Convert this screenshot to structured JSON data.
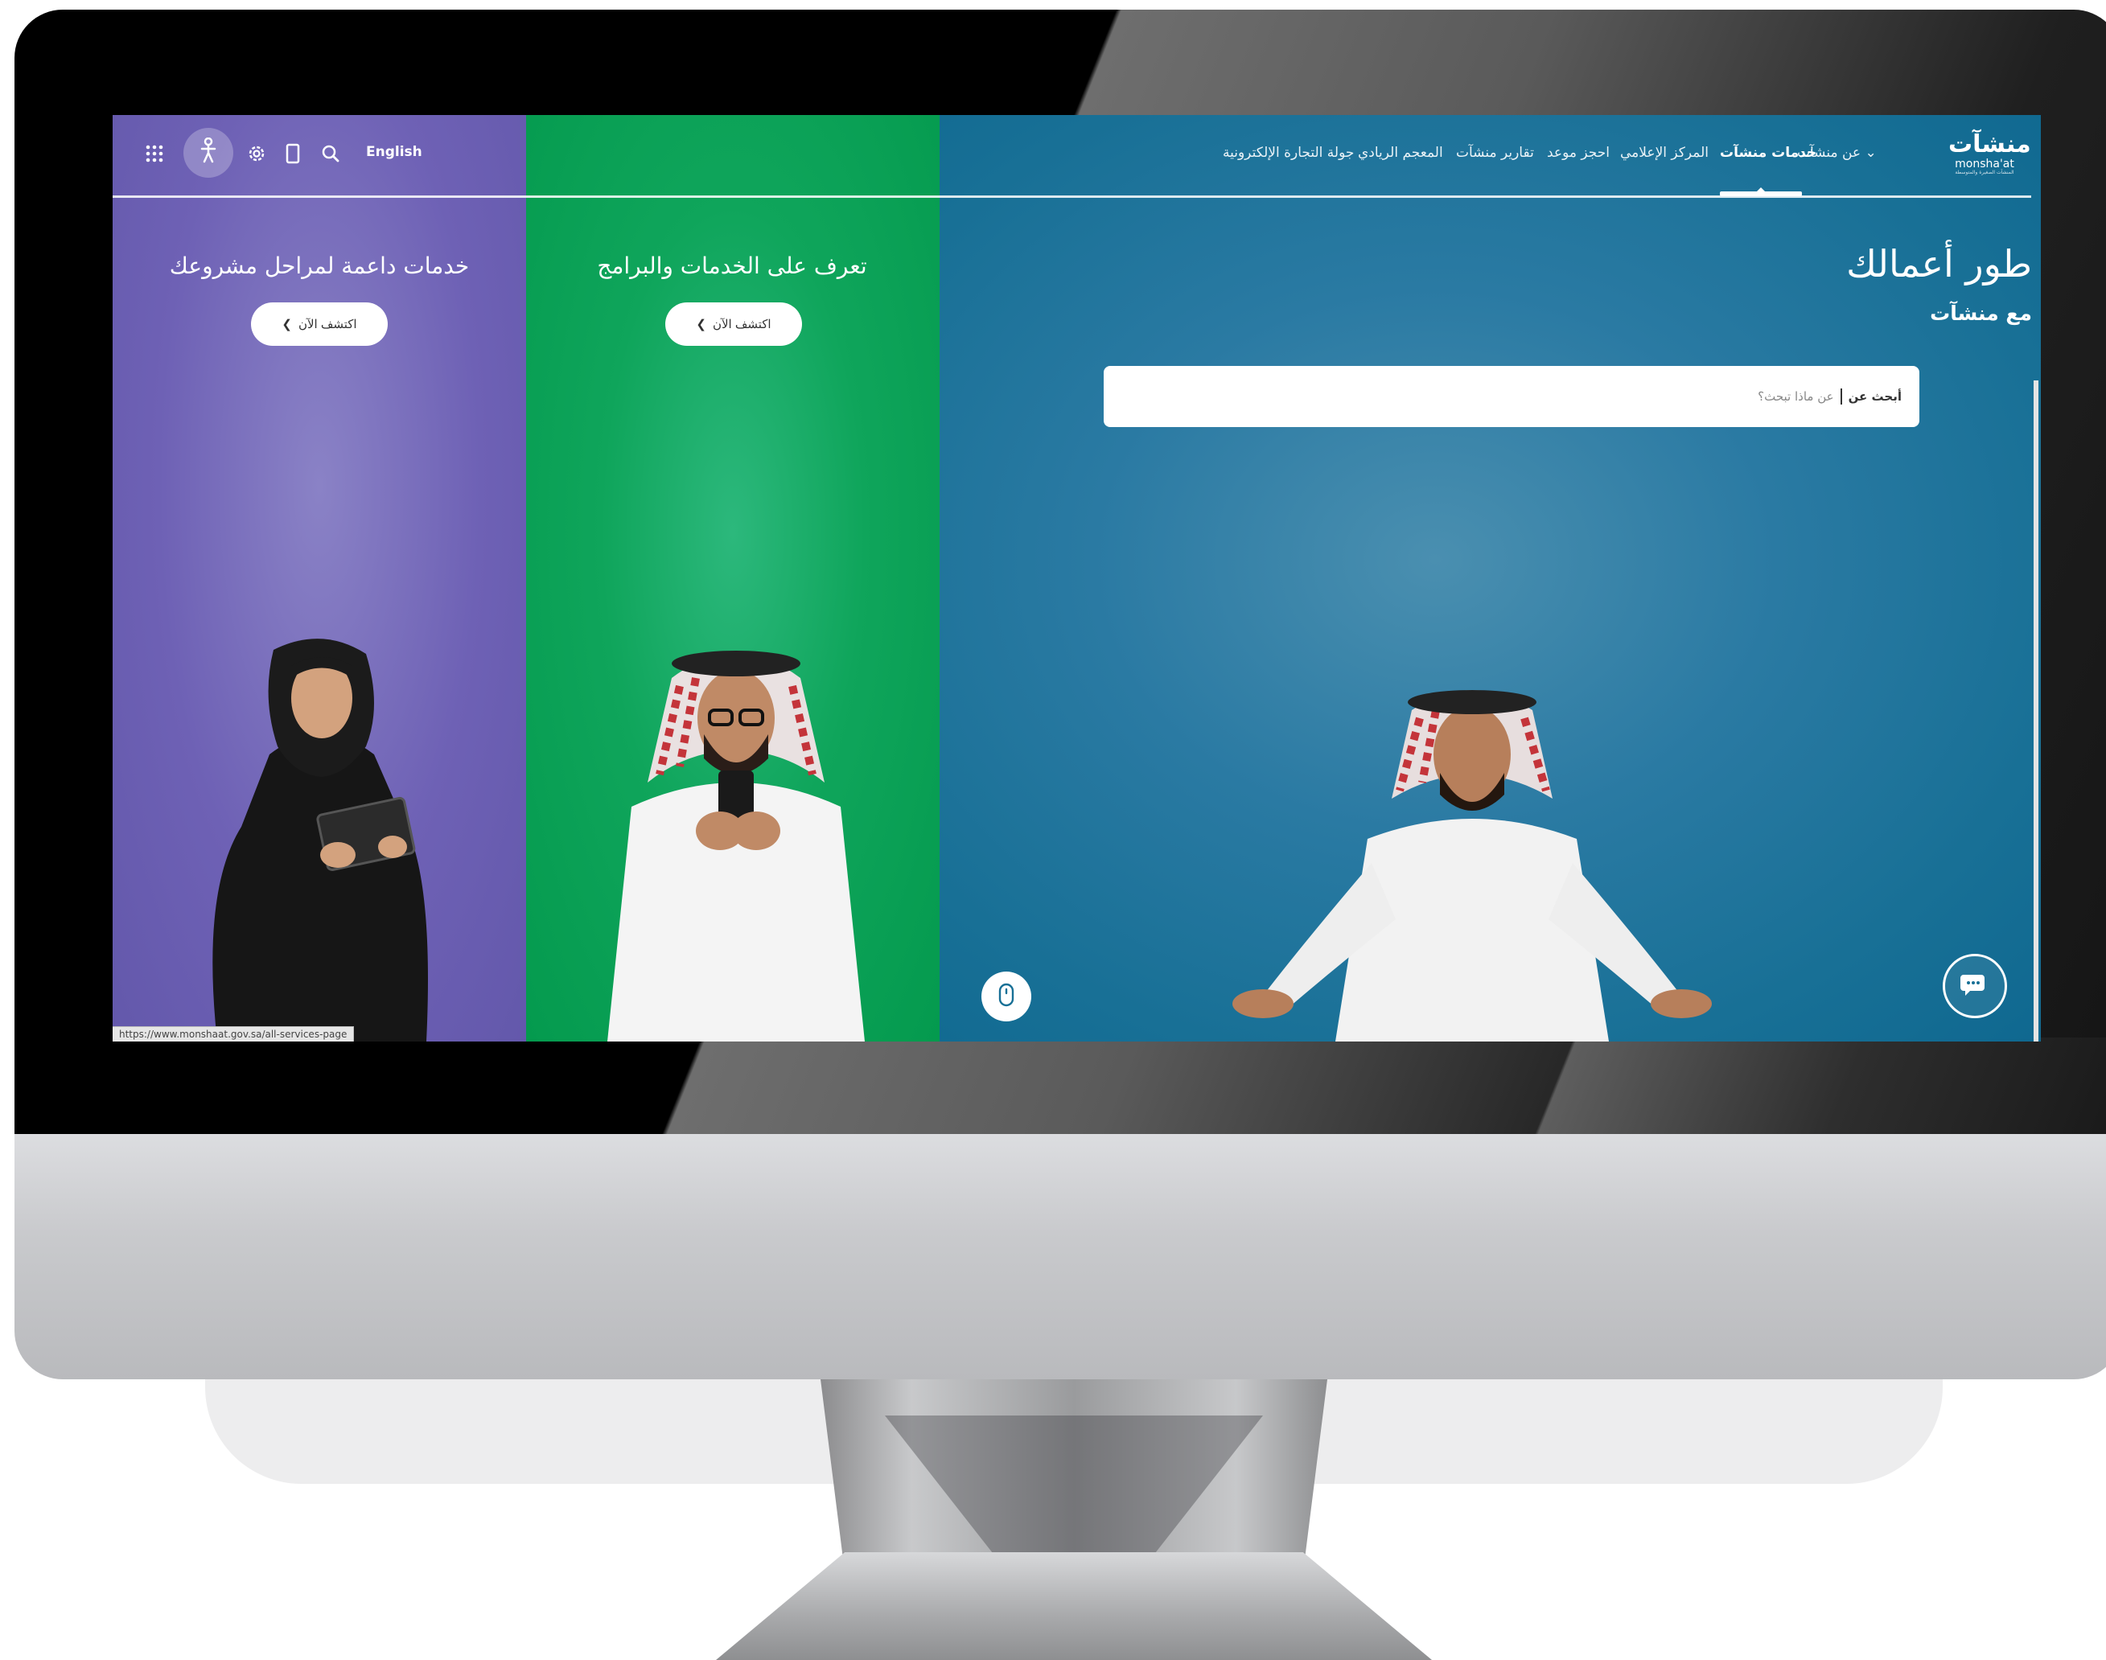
{
  "brand": {
    "logo_ar": "منشآت",
    "logo_en": "monsha'at",
    "logo_sub": "المنشآت الصغيرة والمتوسطة"
  },
  "nav": {
    "items": [
      {
        "label": "عن منشآت ⌄",
        "active": false
      },
      {
        "label": "خدمات منشآت",
        "active": true
      },
      {
        "label": "المركز الإعلامي",
        "active": false
      },
      {
        "label": "احجز موعد",
        "active": false
      },
      {
        "label": "تقارير منشآت",
        "active": false
      },
      {
        "label": "المعجم الريادي",
        "active": false
      },
      {
        "label": "جولة التجارة الإلكترونية",
        "active": false
      }
    ],
    "language_link": "English",
    "icons": [
      "search-icon",
      "mobile-icon",
      "gear-icon",
      "accessibility-icon",
      "apps-grid-icon"
    ]
  },
  "hero": {
    "title": "طور أعمالك",
    "subtitle": "مع منشآت",
    "search": {
      "label": "أبحث عن",
      "placeholder": "عن ماذا تبحث؟"
    }
  },
  "panels": {
    "services": {
      "heading": "تعرف على الخدمات والبرامج",
      "button": "اكتشف الآن"
    },
    "support": {
      "heading": "خدمات داعمة لمراحل مشروعك",
      "button": "اكتشف الآن"
    }
  },
  "status_bar": {
    "url": "https://www.monshaat.gov.sa/all-services-page"
  },
  "colors": {
    "purple": "#6e61b5",
    "green": "#049a4e",
    "blue": "#187096"
  }
}
